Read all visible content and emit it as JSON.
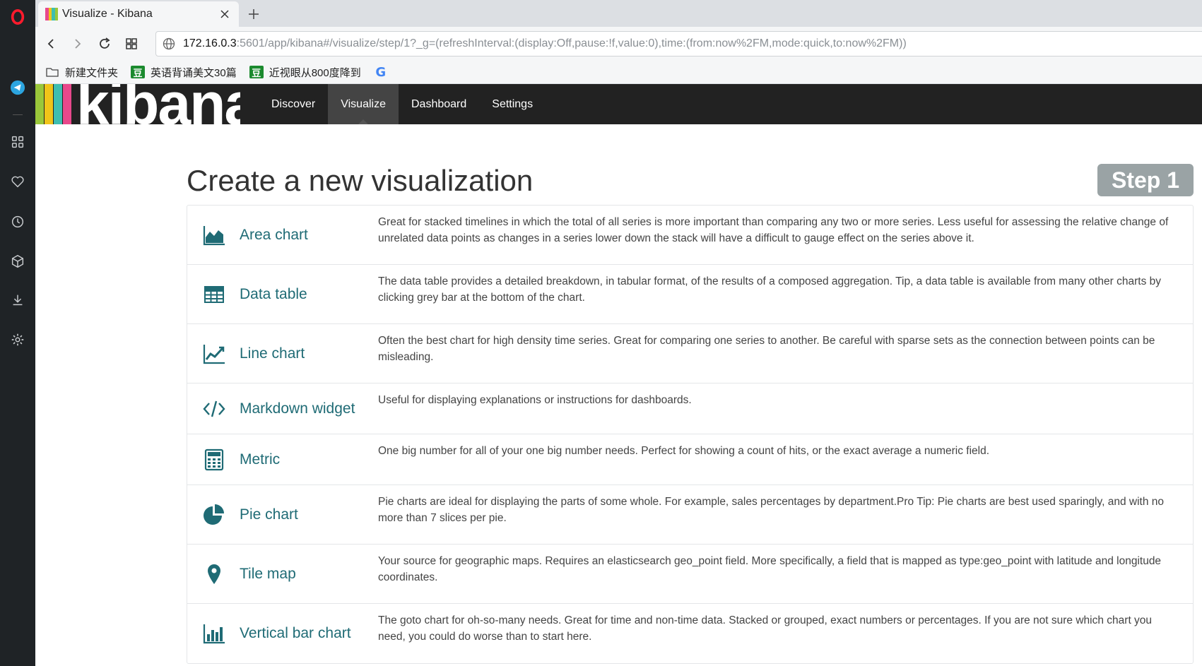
{
  "browser": {
    "tab_title": "Visualize - Kibana",
    "url_host": "172.16.0.3",
    "url_rest": ":5601/app/kibana#/visualize/step/1?_g=(refreshInterval:(display:Off,pause:!f,value:0),time:(from:now%2FM,mode:quick,to:now%2FM))",
    "bookmarks": [
      {
        "label": "新建文件夹",
        "icon": "folder-icon"
      },
      {
        "label": "英语背诵美文30篇",
        "icon": "douban-icon",
        "badge": "豆"
      },
      {
        "label": "近视眼从800度降到",
        "icon": "douban-icon",
        "badge": "豆"
      },
      {
        "label": "",
        "icon": "google-icon",
        "badge": "G"
      }
    ]
  },
  "kibana": {
    "logo_text": "kibana",
    "nav": [
      {
        "label": "Discover",
        "active": false
      },
      {
        "label": "Visualize",
        "active": true
      },
      {
        "label": "Dashboard",
        "active": false
      },
      {
        "label": "Settings",
        "active": false
      }
    ]
  },
  "main": {
    "title": "Create a new visualization",
    "step_label": "Step 1",
    "types": [
      {
        "icon": "area-chart-icon",
        "name": "Area chart",
        "description": "Great for stacked timelines in which the total of all series is more important than comparing any two or more series. Less useful for assessing the relative change of unrelated data points as changes in a series lower down the stack will have a difficult to gauge effect on the series above it."
      },
      {
        "icon": "data-table-icon",
        "name": "Data table",
        "description": "The data table provides a detailed breakdown, in tabular format, of the results of a composed aggregation. Tip, a data table is available from many other charts by clicking grey bar at the bottom of the chart."
      },
      {
        "icon": "line-chart-icon",
        "name": "Line chart",
        "description": "Often the best chart for high density time series. Great for comparing one series to another. Be careful with sparse sets as the connection between points can be misleading."
      },
      {
        "icon": "code-icon",
        "name": "Markdown widget",
        "description": "Useful for displaying explanations or instructions for dashboards."
      },
      {
        "icon": "calculator-icon",
        "name": "Metric",
        "description": "One big number for all of your one big number needs. Perfect for showing a count of hits, or the exact average a numeric field."
      },
      {
        "icon": "pie-chart-icon",
        "name": "Pie chart",
        "description": "Pie charts are ideal for displaying the parts of some whole. For example, sales percentages by department.Pro Tip: Pie charts are best used sparingly, and with no more than 7 slices per pie."
      },
      {
        "icon": "map-marker-icon",
        "name": "Tile map",
        "description": "Your source for geographic maps. Requires an elasticsearch geo_point field. More specifically, a field that is mapped as type:geo_point with latitude and longitude coordinates."
      },
      {
        "icon": "bar-chart-icon",
        "name": "Vertical bar chart",
        "description": "The goto chart for oh-so-many needs. Great for time and non-time data. Stacked or grouped, exact numbers or percentages. If you are not sure which chart you need, you could do worse than to start here."
      }
    ]
  },
  "colors": {
    "kibana_header": "#222222",
    "nav_active": "#444444",
    "link_teal": "#1f6b75",
    "step_badge": "#9aa3a5",
    "logo_bars": [
      "#e8488b",
      "#f0c419",
      "#3ebeb0",
      "#9ac73a"
    ]
  }
}
